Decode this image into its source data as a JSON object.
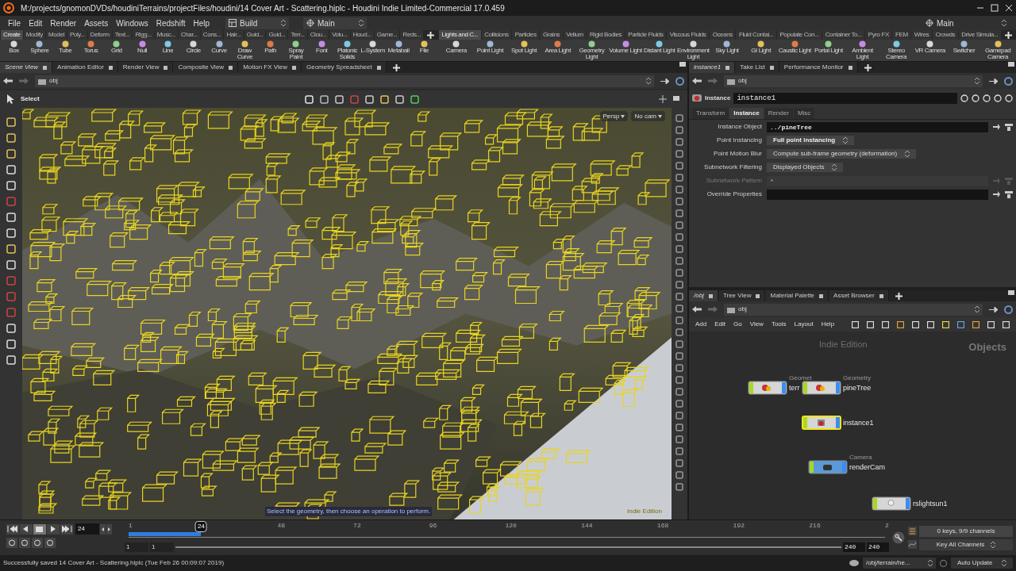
{
  "window": {
    "title": "M:/projects/gnomonDVDs/houdiniTerrains/projectFiles/houdini/14 Cover Art - Scattering.hiplc - Houdini Indie Limited-Commercial 17.0.459"
  },
  "menu": [
    "File",
    "Edit",
    "Render",
    "Assets",
    "Windows",
    "Redshift",
    "Help"
  ],
  "desktops": [
    {
      "label": "Build"
    },
    {
      "label": "Main"
    }
  ],
  "desktop_right": "Main",
  "shelf_left": {
    "tabs": [
      {
        "label": "Create",
        "selected": true
      },
      {
        "label": "Modify",
        "selected": false
      },
      {
        "label": "Model",
        "selected": false
      },
      {
        "label": "Poly...",
        "selected": false
      },
      {
        "label": "Deform",
        "selected": false
      },
      {
        "label": "Text...",
        "selected": false
      },
      {
        "label": "Rigg...",
        "selected": false
      },
      {
        "label": "Musc...",
        "selected": false
      },
      {
        "label": "Char...",
        "selected": false
      },
      {
        "label": "Cons...",
        "selected": false
      },
      {
        "label": "Hair...",
        "selected": false
      },
      {
        "label": "Guid...",
        "selected": false
      },
      {
        "label": "Guid...",
        "selected": false
      },
      {
        "label": "Terr...",
        "selected": false
      },
      {
        "label": "Clou...",
        "selected": false
      },
      {
        "label": "Volu...",
        "selected": false
      },
      {
        "label": "Houd...",
        "selected": false
      },
      {
        "label": "Game...",
        "selected": false
      },
      {
        "label": "Reds...",
        "selected": false
      }
    ],
    "tools": [
      "Box",
      "Sphere",
      "Tube",
      "Torus",
      "Grid",
      "Null",
      "Line",
      "Circle",
      "Curve",
      "Draw Curve",
      "Path",
      "Spray Paint",
      "Font",
      "Platonic Solids",
      "L-System",
      "Metaball",
      "File"
    ]
  },
  "shelf_right": {
    "tabs": [
      {
        "label": "Lights and C...",
        "selected": true
      },
      {
        "label": "Collisions",
        "selected": false
      },
      {
        "label": "Particles",
        "selected": false
      },
      {
        "label": "Grains",
        "selected": false
      },
      {
        "label": "Vellum",
        "selected": false
      },
      {
        "label": "Rigid Bodies",
        "selected": false
      },
      {
        "label": "Particle Fluids",
        "selected": false
      },
      {
        "label": "Viscous Fluids",
        "selected": false
      },
      {
        "label": "Oceans",
        "selected": false
      },
      {
        "label": "Fluid Contai...",
        "selected": false
      },
      {
        "label": "Populate Con...",
        "selected": false
      },
      {
        "label": "Container To...",
        "selected": false
      },
      {
        "label": "Pyro FX",
        "selected": false
      },
      {
        "label": "FEM",
        "selected": false
      },
      {
        "label": "Wires",
        "selected": false
      },
      {
        "label": "Crowds",
        "selected": false
      },
      {
        "label": "Drive Simula...",
        "selected": false
      }
    ],
    "tools": [
      "Camera",
      "Point Light",
      "Spot Light",
      "Area Light",
      "Geometry Light",
      "Volume Light",
      "Distant Light",
      "Environment Light",
      "Sky Light",
      "GI Light",
      "Caustic Light",
      "Portal Light",
      "Ambient Light",
      "Stereo Camera",
      "VR Camera",
      "Switcher",
      "Gamepad Camera"
    ]
  },
  "scene_pane": {
    "tabs": [
      {
        "label": "Scene View",
        "selected": true
      },
      {
        "label": "Animation Editor",
        "selected": false
      },
      {
        "label": "Render View",
        "selected": false
      },
      {
        "label": "Composite View",
        "selected": false
      },
      {
        "label": "Motion FX View",
        "selected": false
      },
      {
        "label": "Geometry Spreadsheet",
        "selected": false
      }
    ],
    "path": "obj",
    "tool": "Select",
    "view_menus": [
      "Persp",
      "No cam"
    ],
    "prompt": "Select the geometry, then choose an operation to perform.",
    "edition": "Indie Edition"
  },
  "parameter_pane": {
    "tabs": [
      {
        "label": "instance1",
        "selected": true
      },
      {
        "label": "Take List",
        "selected": false
      },
      {
        "label": "Performance Monitor",
        "selected": false
      }
    ],
    "path": "obj",
    "node_type": "Instance",
    "node_name": "instance1",
    "param_tabs": [
      {
        "label": "Transform",
        "selected": false
      },
      {
        "label": "Instance",
        "selected": true
      },
      {
        "label": "Render",
        "selected": false
      },
      {
        "label": "Misc",
        "selected": false
      }
    ],
    "params": [
      {
        "label": "Instance Object",
        "kind": "field",
        "value": "../pineTree",
        "disabled": false
      },
      {
        "label": "Point Instancing",
        "kind": "menu",
        "value": "Full point instancing",
        "disabled": false
      },
      {
        "label": "Point Motion Blur",
        "kind": "menu",
        "value": "Compute sub-frame geometry (deformation)",
        "disabled": false
      },
      {
        "label": "Subnetwork Filtering",
        "kind": "menu",
        "value": "Displayed Objects",
        "disabled": false
      },
      {
        "label": "Subnetwork Pattern",
        "kind": "field",
        "value": "*",
        "disabled": true
      },
      {
        "label": "Override Properties",
        "kind": "field",
        "disabled": false
      }
    ]
  },
  "network_pane": {
    "tabs": [
      {
        "label": "/obj",
        "selected": true
      },
      {
        "label": "Tree View",
        "selected": false
      },
      {
        "label": "Material Palette",
        "selected": false
      },
      {
        "label": "Asset Browser",
        "selected": false
      }
    ],
    "path": "obj",
    "menus": [
      "Add",
      "Edit",
      "Go",
      "View",
      "Tools",
      "Layout",
      "Help"
    ],
    "edition": "Indie Edition",
    "context": "Objects",
    "nodes": [
      {
        "type_label": "Geomet",
        "name": "terr",
        "kind": "geometry",
        "selected": false
      },
      {
        "type_label": "Geometry",
        "name": "pineTree",
        "kind": "geometry",
        "selected": false
      },
      {
        "name": "instance1",
        "kind": "instance",
        "selected": true
      },
      {
        "type_label": "Camera",
        "name": "renderCam",
        "kind": "camera",
        "selected": false
      },
      {
        "name": "rslightsun1",
        "kind": "light",
        "selected": false
      }
    ]
  },
  "timeline": {
    "frame": "24",
    "marker": "24",
    "level": 0.096,
    "ticks": [
      "1",
      "48",
      "72",
      "96",
      "120",
      "144",
      "168",
      "192",
      "216",
      "2"
    ],
    "start": [
      "1",
      "1"
    ],
    "end": [
      "240",
      "240"
    ],
    "keys": "0 keys, 9/9 channels",
    "key_mode": "Key All Channels"
  },
  "status_bar": {
    "message": "Successfully saved 14 Cover Art - Scattering.hiplc (Tue Feb 26 00:09:07 2019)",
    "path": "/obj/terrain/he...",
    "update": "Auto Update"
  }
}
